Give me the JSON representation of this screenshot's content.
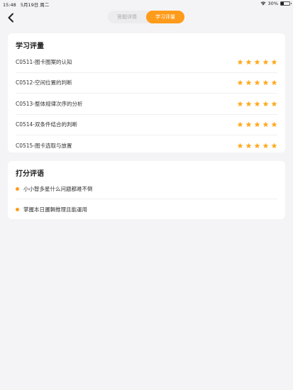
{
  "status": {
    "time": "15:48",
    "date": "5月19日 周二",
    "battery_percent": "30%",
    "battery_level": 0.3
  },
  "nav": {
    "back_icon": "chevron-left-icon",
    "tabs": [
      {
        "label": "答题详情",
        "active": false
      },
      {
        "label": "学习评量",
        "active": true
      }
    ]
  },
  "evaluation": {
    "title": "学习评量",
    "items": [
      {
        "label": "C0511-图卡图案的认知",
        "stars": 5
      },
      {
        "label": "C0512-空间位置的判断",
        "stars": 5
      },
      {
        "label": "C0513-整体规律次序的分析",
        "stars": 5
      },
      {
        "label": "C0514-双条件结合的判断",
        "stars": 5
      },
      {
        "label": "C0515-图卡选取与放置",
        "stars": 5
      }
    ]
  },
  "comments": {
    "title": "打分评语",
    "items": [
      {
        "text": "小小智多星什么问题都难不倒"
      },
      {
        "text": "掌握本日邏輯推理且能運用"
      }
    ]
  },
  "colors": {
    "accent": "#ff9b1a",
    "star": "#ffaa1f",
    "background": "#f4f4f6"
  }
}
